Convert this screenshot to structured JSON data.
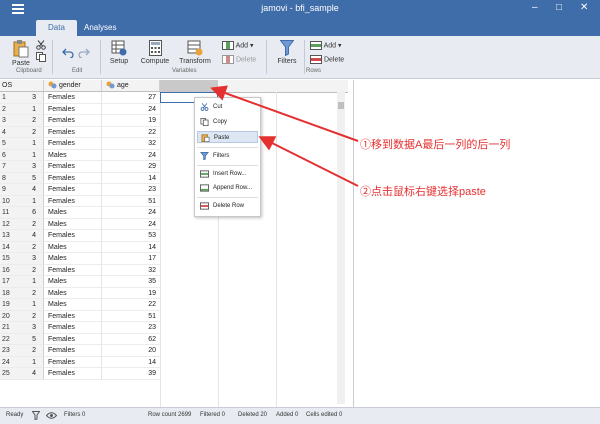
{
  "window": {
    "title": "jamovi - bfi_sample",
    "minimize": "–",
    "maximize": "□",
    "close": "✕"
  },
  "tabs": [
    {
      "label": "Data"
    },
    {
      "label": "Analyses"
    }
  ],
  "ribbon": {
    "paste": "Paste",
    "clipboard_group": "Clipboard",
    "edit_group": "Edit",
    "setup": "Setup",
    "compute": "Compute",
    "transform": "Transform",
    "add": "Add",
    "delete": "Delete",
    "variables_group": "Variables",
    "filters": "Filters",
    "rows_add": "Add",
    "rows_delete": "Delete",
    "rows_group": "Rows"
  },
  "grid": {
    "rownum_header": "OS",
    "columns": [
      {
        "name": "gender"
      },
      {
        "name": "age"
      }
    ],
    "rows": [
      {
        "num": "1",
        "code": "3",
        "gender": "Females",
        "age": "27"
      },
      {
        "num": "2",
        "code": "1",
        "gender": "Females",
        "age": "24"
      },
      {
        "num": "3",
        "code": "2",
        "gender": "Females",
        "age": "19"
      },
      {
        "num": "4",
        "code": "2",
        "gender": "Females",
        "age": "22"
      },
      {
        "num": "5",
        "code": "1",
        "gender": "Females",
        "age": "32"
      },
      {
        "num": "6",
        "code": "1",
        "gender": "Males",
        "age": "24"
      },
      {
        "num": "7",
        "code": "3",
        "gender": "Females",
        "age": "29"
      },
      {
        "num": "8",
        "code": "5",
        "gender": "Females",
        "age": "14"
      },
      {
        "num": "9",
        "code": "4",
        "gender": "Females",
        "age": "23"
      },
      {
        "num": "10",
        "code": "1",
        "gender": "Females",
        "age": "51"
      },
      {
        "num": "11",
        "code": "6",
        "gender": "Males",
        "age": "24"
      },
      {
        "num": "12",
        "code": "2",
        "gender": "Males",
        "age": "24"
      },
      {
        "num": "13",
        "code": "4",
        "gender": "Females",
        "age": "53"
      },
      {
        "num": "14",
        "code": "2",
        "gender": "Males",
        "age": "14"
      },
      {
        "num": "15",
        "code": "3",
        "gender": "Males",
        "age": "17"
      },
      {
        "num": "16",
        "code": "2",
        "gender": "Females",
        "age": "32"
      },
      {
        "num": "17",
        "code": "1",
        "gender": "Males",
        "age": "35"
      },
      {
        "num": "18",
        "code": "2",
        "gender": "Males",
        "age": "19"
      },
      {
        "num": "19",
        "code": "1",
        "gender": "Males",
        "age": "22"
      },
      {
        "num": "20",
        "code": "2",
        "gender": "Females",
        "age": "51"
      },
      {
        "num": "21",
        "code": "3",
        "gender": "Females",
        "age": "23"
      },
      {
        "num": "22",
        "code": "5",
        "gender": "Females",
        "age": "62"
      },
      {
        "num": "23",
        "code": "2",
        "gender": "Females",
        "age": "20"
      },
      {
        "num": "24",
        "code": "1",
        "gender": "Females",
        "age": "14"
      },
      {
        "num": "25",
        "code": "4",
        "gender": "Females",
        "age": "39"
      }
    ]
  },
  "context_menu": {
    "items": [
      {
        "label": "Cut",
        "icon": "scissors-icon"
      },
      {
        "label": "Copy",
        "icon": "copy-icon"
      },
      {
        "label": "Paste",
        "icon": "paste-icon",
        "highlighted": true
      },
      {
        "label": "Filters",
        "icon": "filter-icon"
      },
      {
        "label": "Insert Row...",
        "icon": "insert-row-icon"
      },
      {
        "label": "Append Row...",
        "icon": "append-row-icon"
      },
      {
        "label": "Delete Row",
        "icon": "delete-row-icon"
      }
    ]
  },
  "annotations": {
    "step1": "①移到数据A最后一列的后一列",
    "step2": "②点击鼠标右键选择paste",
    "color": "#e53030"
  },
  "status": {
    "ready": "Ready",
    "filters": "Filters 0",
    "row_count": "Row count 2699",
    "filtered": "Filtered 0",
    "deleted": "Deleted 20",
    "added": "Added 0",
    "cells_edited": "Cells edited 0"
  },
  "colors": {
    "accent": "#3e6da9",
    "ribbon": "#e8ecf2",
    "highlight": "#dde6f3"
  }
}
